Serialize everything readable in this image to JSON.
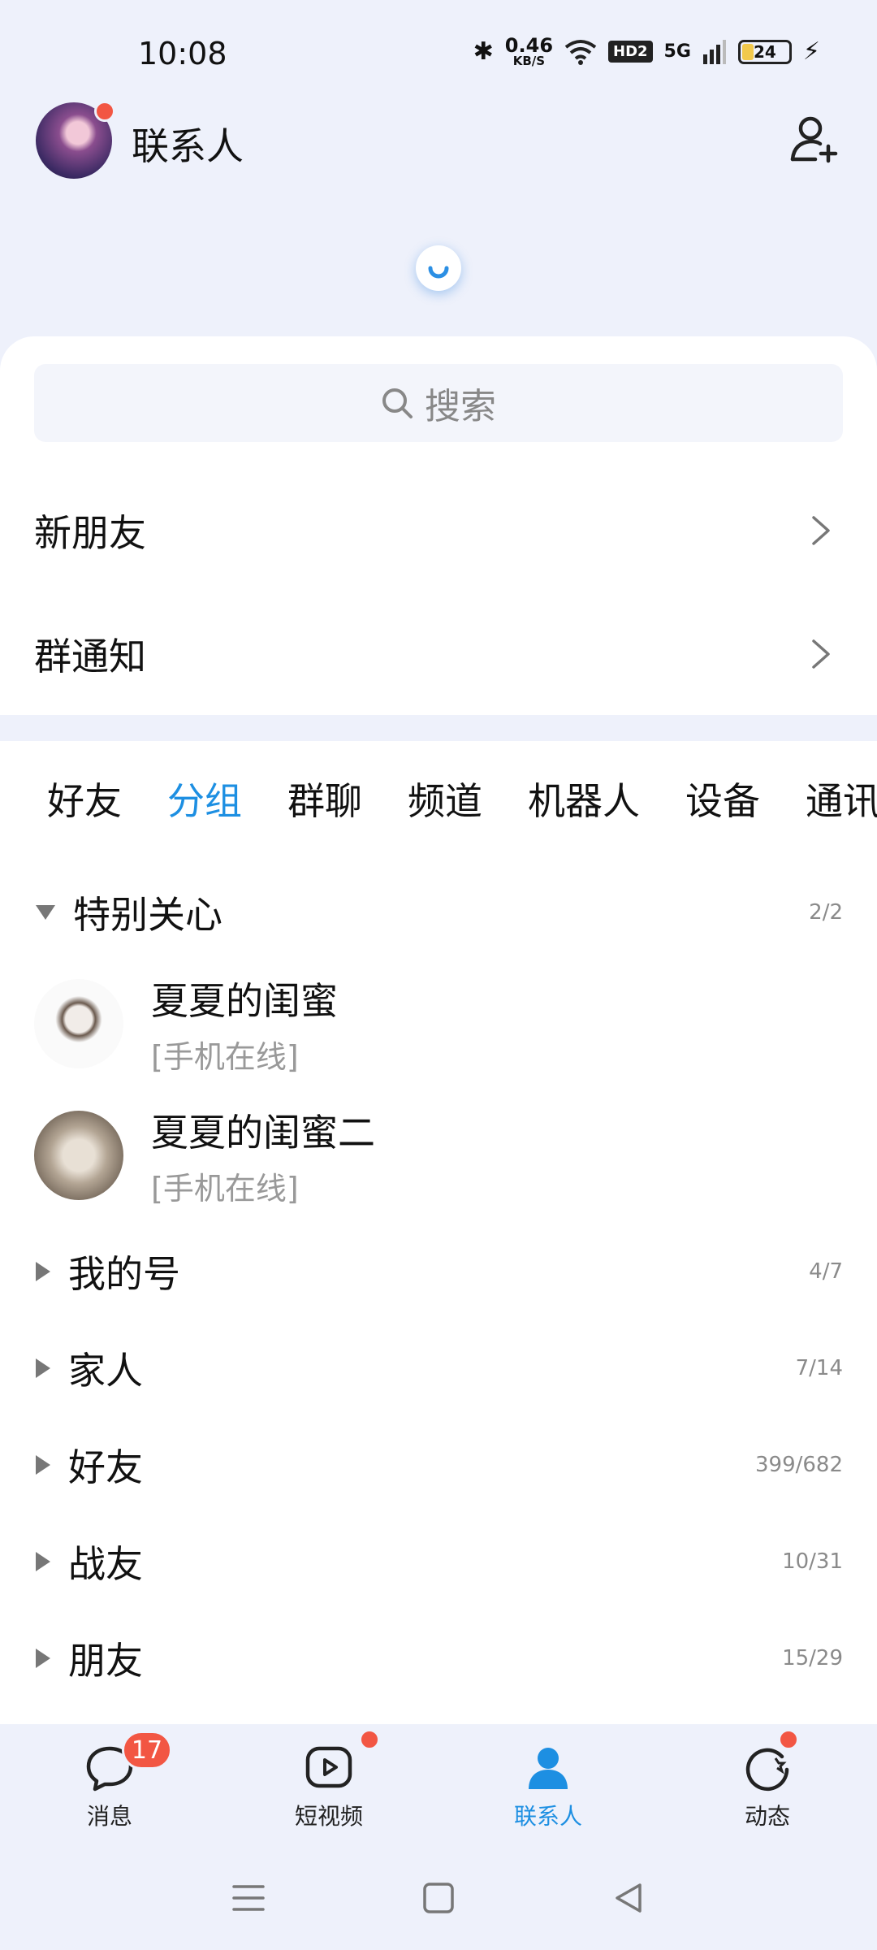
{
  "status": {
    "time": "10:08",
    "net_speed_value": "0.46",
    "net_speed_unit": "KB/S",
    "hd": "HD2",
    "signal": "5G",
    "battery": "24"
  },
  "header": {
    "title": "联系人",
    "avatar_has_dot": true
  },
  "search": {
    "placeholder": "搜索"
  },
  "rows": [
    {
      "label": "新朋友"
    },
    {
      "label": "群通知"
    }
  ],
  "tabs": [
    {
      "label": "好友",
      "active": false
    },
    {
      "label": "分组",
      "active": true
    },
    {
      "label": "群聊",
      "active": false
    },
    {
      "label": "频道",
      "active": false
    },
    {
      "label": "机器人",
      "active": false
    },
    {
      "label": "设备",
      "active": false
    },
    {
      "label": "通讯录",
      "active": false
    }
  ],
  "groups": [
    {
      "name": "特别关心",
      "count": "2/2",
      "expanded": true
    },
    {
      "name": "我的号",
      "count": "4/7",
      "expanded": false
    },
    {
      "name": "家人",
      "count": "7/14",
      "expanded": false
    },
    {
      "name": "好友",
      "count": "399/682",
      "expanded": false
    },
    {
      "name": "战友",
      "count": "10/31",
      "expanded": false
    },
    {
      "name": "朋友",
      "count": "15/29",
      "expanded": false
    }
  ],
  "contacts": [
    {
      "name": "夏夏的闺蜜",
      "status": "[手机在线]"
    },
    {
      "name": "夏夏的闺蜜二",
      "status": "[手机在线]"
    }
  ],
  "nav": [
    {
      "label": "消息",
      "badge": "17",
      "active": false
    },
    {
      "label": "短视频",
      "dot": true,
      "active": false
    },
    {
      "label": "联系人",
      "active": true
    },
    {
      "label": "动态",
      "dot": true,
      "active": false
    }
  ],
  "colors": {
    "accent": "#1d8fe2",
    "badge": "#f25643",
    "background": "#eef1fb"
  }
}
